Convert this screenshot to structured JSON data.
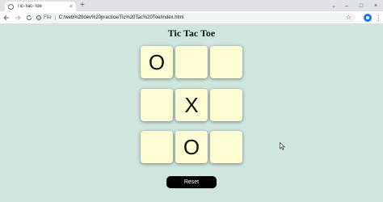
{
  "browser": {
    "tab_title": "Tic-Tac-Toe",
    "tab_close": "×",
    "new_tab": "+",
    "scheme_label": "File",
    "url": "C:/web%20dev%20practice/Tic%20Tac%20Toe/index.html",
    "window_controls": [
      "–",
      "□",
      "×"
    ],
    "tab_search": "⌄"
  },
  "page": {
    "title": "Tic Tac Toe",
    "board": [
      "O",
      "",
      "",
      "",
      "X",
      "",
      "",
      "O",
      ""
    ],
    "reset_label": "Reset"
  },
  "colors": {
    "background": "#cfe6df",
    "cell": "#fdfcd2",
    "button": "#000000"
  }
}
